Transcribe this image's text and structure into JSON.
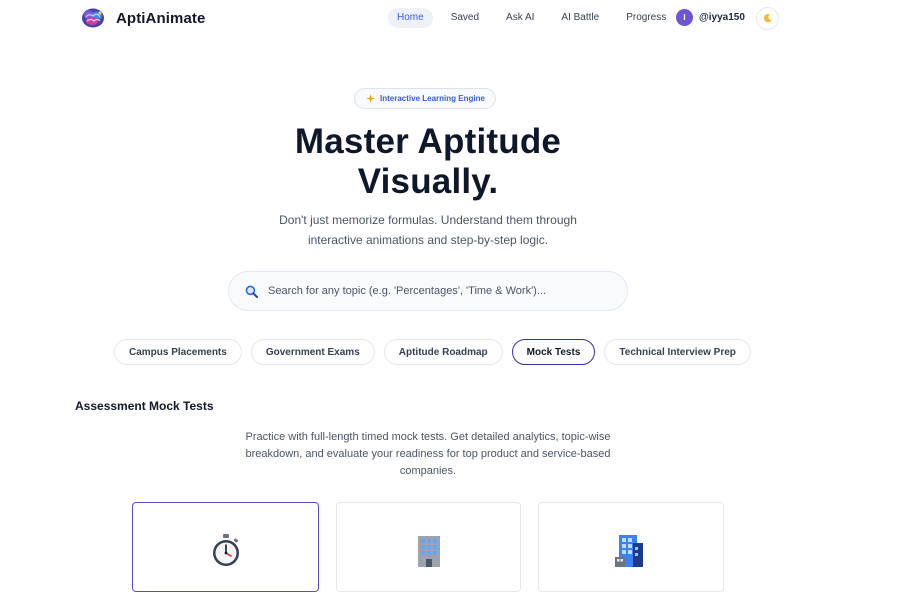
{
  "nav": {
    "brand": "AptiAnimate",
    "links": [
      {
        "label": "Home",
        "active": true
      },
      {
        "label": "Saved",
        "active": false
      },
      {
        "label": "Ask AI",
        "active": false
      },
      {
        "label": "AI Battle",
        "active": false
      },
      {
        "label": "Progress",
        "active": false
      }
    ],
    "user": {
      "initial": "I",
      "username": "@iyya150"
    },
    "theme_icon": "moon-icon"
  },
  "hero": {
    "badge": "Interactive Learning Engine",
    "title_line1": "Master Aptitude",
    "title_line2": "Visually.",
    "subtitle": "Don't just memorize formulas. Understand them through interactive animations and step-by-step logic."
  },
  "search": {
    "placeholder": "Search for any topic (e.g. 'Percentages', 'Time & Work')..."
  },
  "filters": [
    {
      "label": "Campus Placements",
      "active": false
    },
    {
      "label": "Government Exams",
      "active": false
    },
    {
      "label": "Aptitude Roadmap",
      "active": false
    },
    {
      "label": "Mock Tests",
      "active": true
    },
    {
      "label": "Technical Interview Prep",
      "active": false
    }
  ],
  "section": {
    "title": "Assessment Mock Tests",
    "description": "Practice with full-length timed mock tests. Get detailed analytics, topic-wise breakdown, and evaluate your readiness for top product and service-based companies."
  },
  "cards": [
    {
      "icon": "stopwatch-icon",
      "active": true
    },
    {
      "icon": "office-building-icon",
      "active": false
    },
    {
      "icon": "company-building-icon",
      "active": false
    }
  ],
  "colors": {
    "accent": "#3b5bdb",
    "avatar": "#6d55d4",
    "active_border": "#5b4bd1"
  }
}
